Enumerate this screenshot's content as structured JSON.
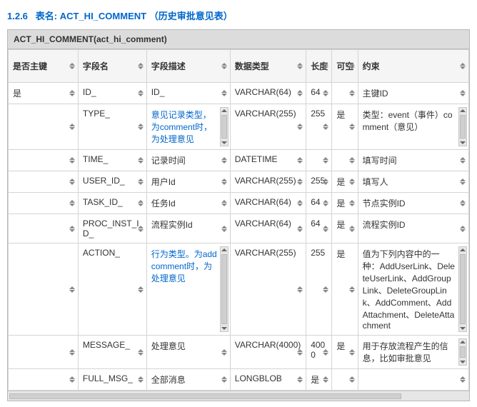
{
  "heading": {
    "num": "1.2.6",
    "label": "表名:",
    "name": "ACT_HI_COMMENT",
    "desc": "（历史审批意见表）"
  },
  "caption": "ACT_HI_COMMENT(act_hi_comment)",
  "headers": [
    "是否主键",
    "字段名",
    "字段描述",
    "数据类型",
    "长度",
    "可空",
    "约束"
  ],
  "rows": [
    {
      "pk": "是",
      "field": "ID_",
      "desc": "ID_",
      "type": "VARCHAR(64)",
      "len": "64",
      "nullable": "",
      "note": "主键ID",
      "descLink": false,
      "descScroll": false,
      "noteScroll": false
    },
    {
      "pk": "",
      "field": "TYPE_",
      "desc": "意见记录类型，为comment时，为处理意见",
      "type": "VARCHAR(255)",
      "len": "255",
      "nullable": "是",
      "note": "类型：event（事件）comment（意见）",
      "descLink": true,
      "descScroll": true,
      "noteScroll": true
    },
    {
      "pk": "",
      "field": "TIME_",
      "desc": "记录时间",
      "type": "DATETIME",
      "len": "",
      "nullable": "",
      "note": "填写时间",
      "descLink": false,
      "descScroll": false,
      "noteScroll": false
    },
    {
      "pk": "",
      "field": "USER_ID_",
      "desc": "用户Id",
      "type": "VARCHAR(255)",
      "len": "255",
      "nullable": "是",
      "note": "填写人",
      "descLink": false,
      "descScroll": false,
      "noteScroll": false
    },
    {
      "pk": "",
      "field": "TASK_ID_",
      "desc": "任务Id",
      "type": "VARCHAR(64)",
      "len": "64",
      "nullable": "是",
      "note": "节点实例ID",
      "descLink": false,
      "descScroll": false,
      "noteScroll": false
    },
    {
      "pk": "",
      "field": "PROC_INST_ID_",
      "desc": "流程实例Id",
      "type": "VARCHAR(64)",
      "len": "64",
      "nullable": "是",
      "note": "流程实例ID",
      "descLink": false,
      "descScroll": false,
      "noteScroll": false
    },
    {
      "pk": "",
      "field": "ACTION_",
      "desc": "行为类型。为addcomment时，为处理意见",
      "type": "VARCHAR(255)",
      "len": "255",
      "nullable": "是",
      "note": "值为下列内容中的一种：AddUserLink、DeleteUserLink、AddGroupLink、DeleteGroupLink、AddComment、AddAttachment、DeleteAttachment",
      "descLink": true,
      "descScroll": true,
      "noteScroll": true
    },
    {
      "pk": "",
      "field": "MESSAGE_",
      "desc": "处理意见",
      "type": "VARCHAR(4000)",
      "len": "4000",
      "nullable": "是",
      "note": "用于存放流程产生的信息，比如审批意见",
      "descLink": false,
      "descScroll": false,
      "noteScroll": true
    },
    {
      "pk": "",
      "field": "FULL_MSG_",
      "desc": "全部消息",
      "type": "LONGBLOB",
      "len": "是",
      "nullable": "",
      "note": "",
      "descLink": false,
      "descScroll": false,
      "noteScroll": false
    }
  ]
}
